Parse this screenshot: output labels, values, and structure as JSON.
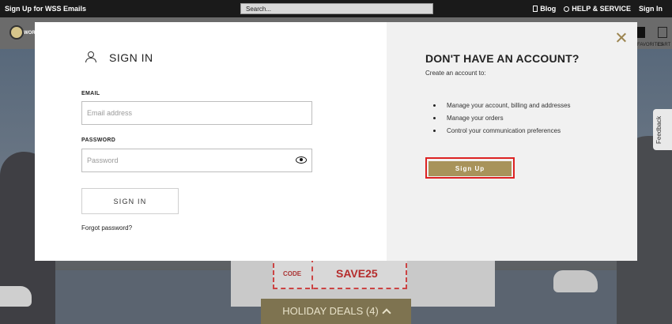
{
  "topbar": {
    "promo": "Sign Up for WSS Emails",
    "search_placeholder": "Search...",
    "blog": "Blog",
    "help": "HELP & SERVICE",
    "sign_in": "Sign In"
  },
  "background": {
    "logo_text": "WOR",
    "favorites": "FAVORITES",
    "cart": "CART",
    "code_label": "CODE",
    "code_value": "SAVE25",
    "deals": "HOLIDAY DEALS (4)"
  },
  "feedback": "Feedback",
  "signin": {
    "title": "SIGN IN",
    "email_label": "EMAIL",
    "email_placeholder": "Email address",
    "password_label": "PASSWORD",
    "password_placeholder": "Password",
    "button": "SIGN IN",
    "forgot": "Forgot password?"
  },
  "signup": {
    "title": "DON'T HAVE AN ACCOUNT?",
    "subtitle": "Create an account to:",
    "benefits": [
      "Manage your account, billing and addresses",
      "Manage your orders",
      "Control your communication preferences"
    ],
    "button": "Sign Up"
  },
  "colors": {
    "accent": "#a8935a",
    "highlight": "#dd2222"
  }
}
